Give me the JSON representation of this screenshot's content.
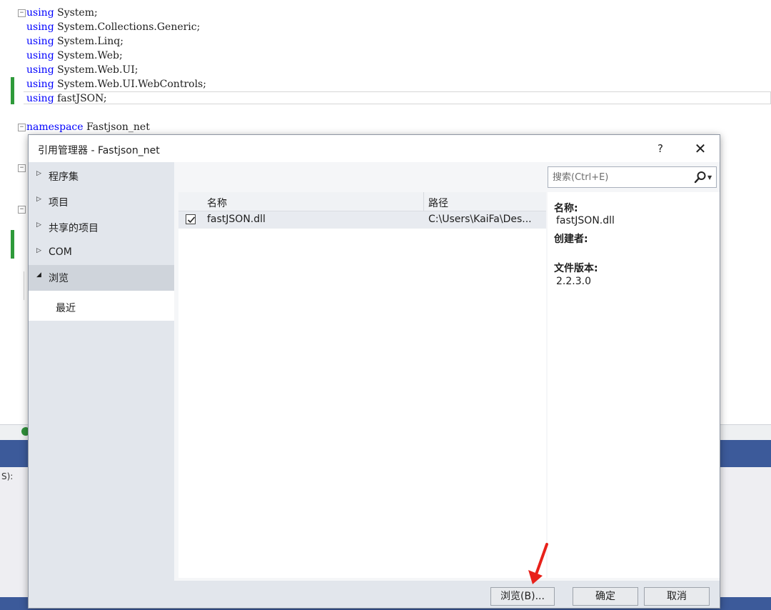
{
  "editor": {
    "lines": [
      {
        "keyword": "using",
        "rest": " System;"
      },
      {
        "keyword": "using",
        "rest": " System.Collections.Generic;"
      },
      {
        "keyword": "using",
        "rest": " System.Linq;"
      },
      {
        "keyword": "using",
        "rest": " System.Web;"
      },
      {
        "keyword": "using",
        "rest": " System.Web.UI;"
      },
      {
        "keyword": "using",
        "rest": " System.Web.UI.WebControls;"
      },
      {
        "keyword": "using",
        "rest": " fastJSON;"
      },
      {
        "keyword": "namespace",
        "rest": " Fastjson_net"
      }
    ],
    "fold_glyph": "−",
    "bottom_snippet": "S):"
  },
  "dialog": {
    "title": "引用管理器 - Fastjson_net",
    "help_label": "?",
    "close_label": "✕",
    "sidebar": {
      "items": [
        {
          "label": "程序集",
          "arrow": "▷"
        },
        {
          "label": "项目",
          "arrow": "▷"
        },
        {
          "label": "共享的项目",
          "arrow": "▷"
        },
        {
          "label": "COM",
          "arrow": "▷"
        },
        {
          "label": "浏览",
          "arrow": "◢"
        }
      ],
      "sub_item": "最近"
    },
    "search": {
      "placeholder": "搜索(Ctrl+E)"
    },
    "list": {
      "columns": [
        "名称",
        "路径"
      ],
      "rows": [
        {
          "checked": true,
          "name": "fastJSON.dll",
          "path": "C:\\Users\\KaiFa\\Des..."
        }
      ]
    },
    "details": {
      "name_label": "名称:",
      "name_value": "fastJSON.dll",
      "creator_label": "创建者:",
      "version_label": "文件版本:",
      "version_value": "2.2.3.0"
    },
    "buttons": {
      "browse": "浏览(B)...",
      "ok": "确定",
      "cancel": "取消"
    }
  },
  "colors": {
    "keyword": "#0000ff",
    "change_bar": "#2e9a3a",
    "pointer_arrow": "#e8211a",
    "panel_blue": "#3c5a9a"
  }
}
